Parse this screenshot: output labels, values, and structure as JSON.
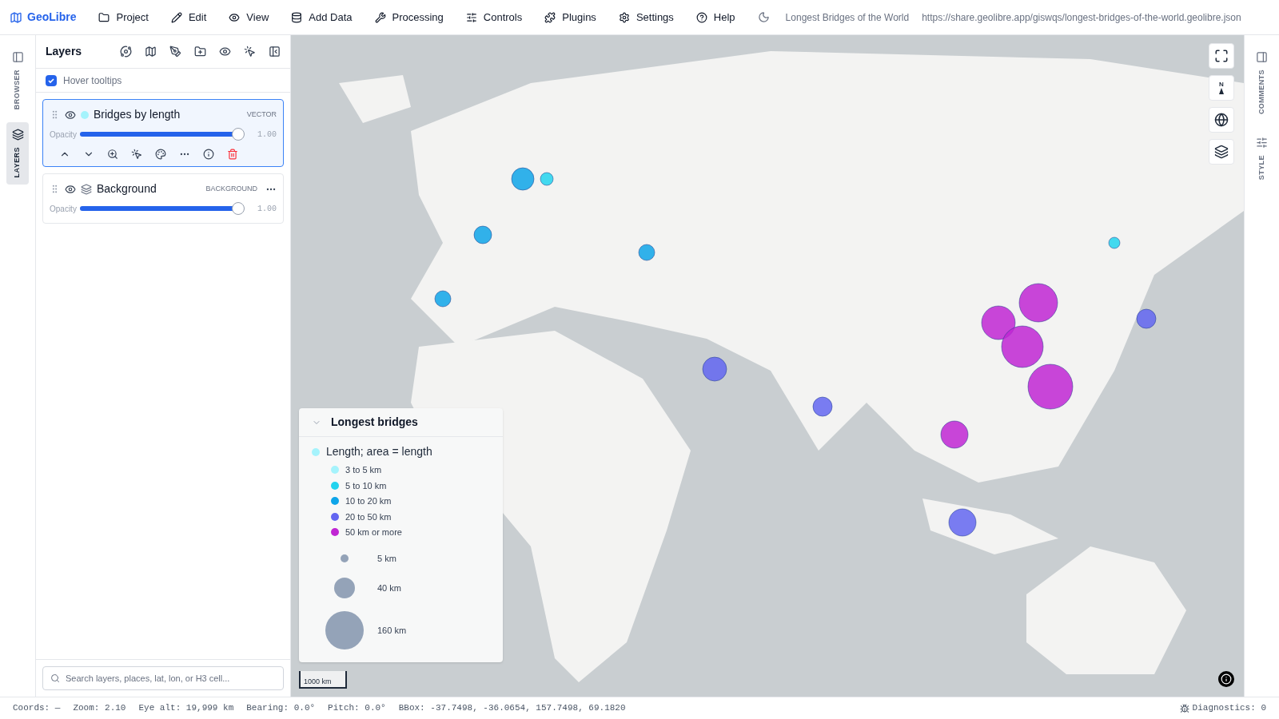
{
  "app": {
    "name": "GeoLibre"
  },
  "menu": [
    {
      "label": "Project"
    },
    {
      "label": "Edit"
    },
    {
      "label": "View"
    },
    {
      "label": "Add Data"
    },
    {
      "label": "Processing"
    },
    {
      "label": "Controls"
    },
    {
      "label": "Plugins"
    },
    {
      "label": "Settings"
    },
    {
      "label": "Help"
    }
  ],
  "project_title": "Longest Bridges of the World",
  "project_url": "https://share.geolibre.app/giswqs/longest-bridges-of-the-world.geolibre.json",
  "left_rail": [
    {
      "label": "BROWSER",
      "selected": false
    },
    {
      "label": "LAYERS",
      "selected": true
    }
  ],
  "layers_panel": {
    "title": "Layers",
    "hover_tooltips": {
      "label": "Hover tooltips",
      "checked": true
    },
    "layers": [
      {
        "name": "Bridges by length",
        "type": "VECTOR",
        "kind": "vector",
        "color": "#a5f3fc",
        "selected": true,
        "visible": true,
        "opacity_label": "Opacity",
        "level": 1,
        "reading": "1.00"
      },
      {
        "name": "Background",
        "type": "BACKGROUND",
        "kind": "background",
        "selected": false,
        "visible": true,
        "opacity_label": "Opacity",
        "level": 1,
        "reading": "1.00"
      }
    ],
    "search": {
      "placeholder": "Search layers, places, lat, lon, or H3 cell..."
    }
  },
  "legend": {
    "title": "Longest bridges",
    "expanded": true,
    "series": [
      {
        "label": "Length; area = length",
        "color": "#a5f3fc"
      }
    ],
    "classes": [
      {
        "label": "3 to 5 km",
        "color": "#a5f3fc"
      },
      {
        "label": "5 to 10 km",
        "color": "#22d3ee"
      },
      {
        "label": "10 to 20 km",
        "color": "#0ea5e9"
      },
      {
        "label": "20 to 50 km",
        "color": "#6366f1"
      },
      {
        "label": "50 km or more",
        "color": "#c026d3"
      }
    ],
    "sizes": [
      {
        "label": "5 km"
      },
      {
        "label": "40 km"
      },
      {
        "label": "160 km"
      }
    ]
  },
  "scale": "1000 km",
  "map_controls": {
    "compass": "N"
  },
  "right_rail": [
    {
      "label": "COMMENTS",
      "selected": false
    },
    {
      "label": "STYLE",
      "selected": false
    }
  ],
  "status_bar": {
    "items": [
      "Coords: —",
      "Zoom: 2.10",
      "Eye alt: 19,999 km",
      "Bearing: 0.0°",
      "Pitch: 0.0°",
      "BBox: -37.7498, -36.0654, 157.7498, 69.1820"
    ],
    "diagnostics": "Diagnostics: 0"
  }
}
